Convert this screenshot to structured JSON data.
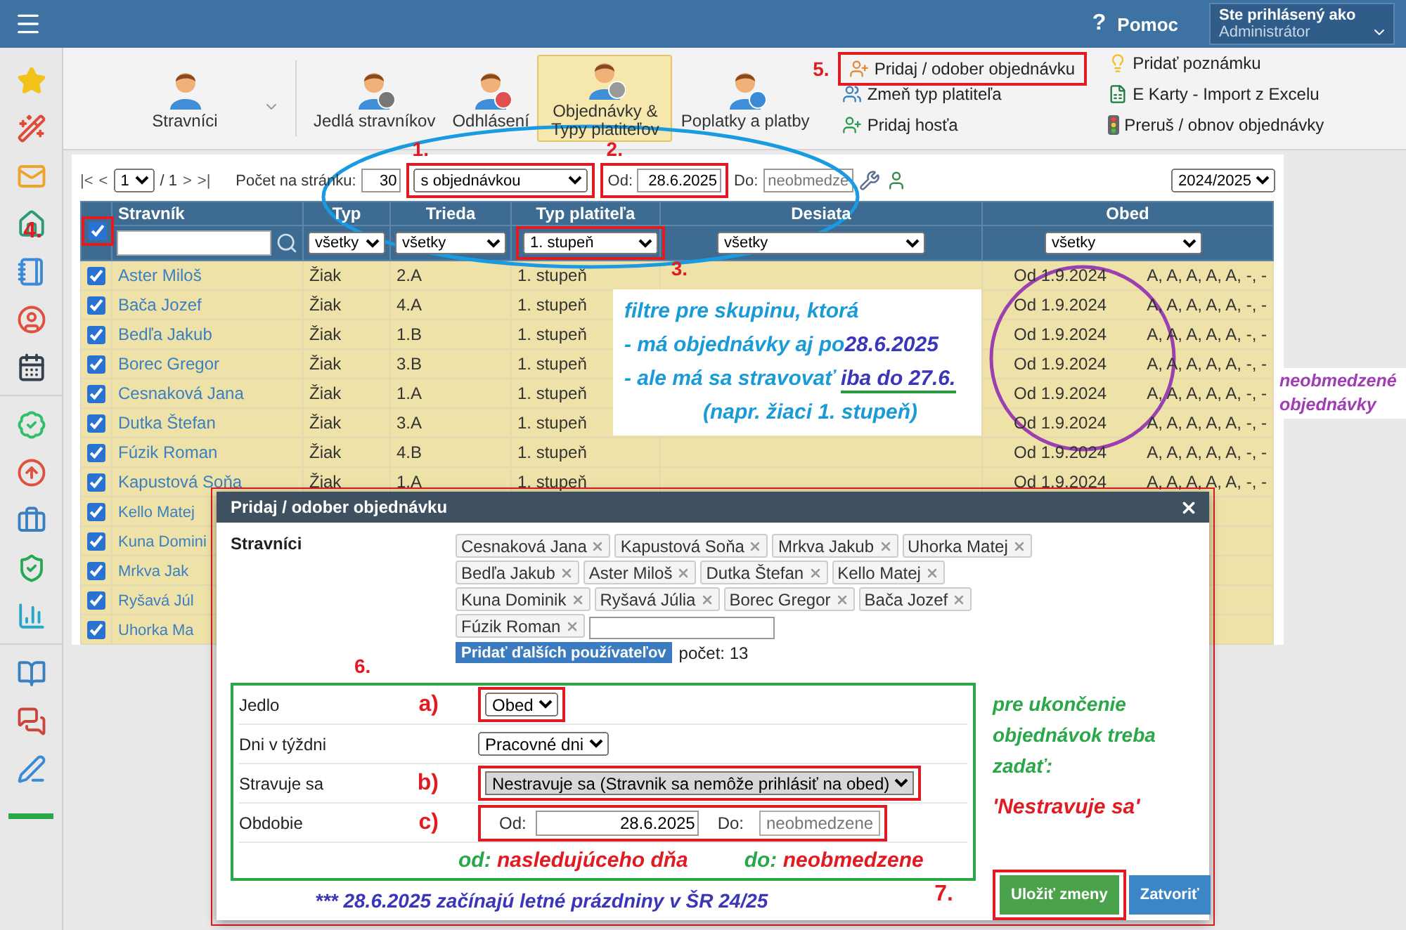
{
  "header": {
    "help_icon": "?",
    "help": "Pomoc",
    "user_label": "Ste prihlásený ako",
    "user_role": "Administrátor"
  },
  "ribbon": {
    "items": [
      {
        "label": "Stravníci",
        "selected": false,
        "dropdown": true
      },
      {
        "label": "Jedlá stravníkov",
        "selected": false
      },
      {
        "label": "Odhlásení",
        "selected": false
      },
      {
        "label": "Objednávky & Typy platiteľov",
        "selected": true
      },
      {
        "label": "Poplatky a platby",
        "selected": false
      }
    ],
    "actions": [
      {
        "label": "Pridaj / odober objednávku",
        "marker": "5."
      },
      {
        "label": "Zmeň typ platiteľa"
      },
      {
        "label": "Pridaj hosťa"
      },
      {
        "label": "Pridať poznámku"
      },
      {
        "label": "E Karty - Import z Excelu"
      },
      {
        "label": "Preruš / obnov objednávky"
      }
    ]
  },
  "pager": {
    "first": "|<",
    "prev": "<",
    "page": "1",
    "of": "/ 1",
    "next": ">",
    "last": ">|",
    "per_page_label": "Počet na stránku:",
    "per_page": "30"
  },
  "filters": {
    "status": {
      "value": "s objednávkou",
      "marker": "1."
    },
    "from": {
      "label": "Od:",
      "value": "28.6.2025",
      "marker": "2."
    },
    "to": {
      "label": "Do:",
      "placeholder": "neobmedze"
    },
    "year": "2024/2025"
  },
  "table": {
    "select_all": {
      "checked": true,
      "marker": "4."
    },
    "columns": [
      "Stravník",
      "Typ",
      "Trieda",
      "Typ platiteľa",
      "Desiata",
      "Obed"
    ],
    "column_filters": [
      {
        "kind": "search"
      },
      {
        "kind": "select",
        "value": "všetky"
      },
      {
        "kind": "select",
        "value": "všetky"
      },
      {
        "kind": "select",
        "value": "1. stupeň",
        "marker": "3."
      },
      {
        "kind": "select",
        "value": "všetky"
      },
      {
        "kind": "select",
        "value": "všetky"
      }
    ],
    "rows": [
      {
        "checked": true,
        "name": "Aster Miloš",
        "type": "Žiak",
        "class": "2.A",
        "payer": "1. stupeň",
        "lunch_from": "Od 1.9.2024",
        "lunch_days": "A, A, A, A, A, -, -"
      },
      {
        "checked": true,
        "name": "Bača Jozef",
        "type": "Žiak",
        "class": "4.A",
        "payer": "1. stupeň",
        "lunch_from": "Od 1.9.2024",
        "lunch_days": "A, A, A, A, A, -, -"
      },
      {
        "checked": true,
        "name": "Bedľa Jakub",
        "type": "Žiak",
        "class": "1.B",
        "payer": "1. stupeň",
        "lunch_from": "Od 1.9.2024",
        "lunch_days": "A, A, A, A, A, -, -"
      },
      {
        "checked": true,
        "name": "Borec Gregor",
        "type": "Žiak",
        "class": "3.B",
        "payer": "1. stupeň",
        "lunch_from": "Od 1.9.2024",
        "lunch_days": "A, A, A, A, A, -, -"
      },
      {
        "checked": true,
        "name": "Cesnaková Jana",
        "type": "Žiak",
        "class": "1.A",
        "payer": "1. stupeň",
        "lunch_from": "Od 1.9.2024",
        "lunch_days": "A, A, A, A, A, -, -"
      },
      {
        "checked": true,
        "name": "Dutka Štefan",
        "type": "Žiak",
        "class": "3.A",
        "payer": "1. stupeň",
        "lunch_from": "Od 1.9.2024",
        "lunch_days": "A, A, A, A, A, -, -"
      },
      {
        "checked": true,
        "name": "Fúzik Roman",
        "type": "Žiak",
        "class": "4.B",
        "payer": "1. stupeň",
        "lunch_from": "Od 1.9.2024",
        "lunch_days": "A, A, A, A, A, -, -"
      },
      {
        "checked": true,
        "name": "Kapustová Soňa",
        "type": "Žiak",
        "class": "1.A",
        "payer": "1. stupeň",
        "lunch_from": "Od 1.9.2024",
        "lunch_days": "A, A, A, A, A, -, -"
      },
      {
        "checked": true,
        "name": "Kello Matej"
      },
      {
        "checked": true,
        "name": "Kuna Domini"
      },
      {
        "checked": true,
        "name": "Mrkva Jak"
      },
      {
        "checked": true,
        "name": "Ryšavá Júl"
      },
      {
        "checked": true,
        "name": "Uhorka Ma"
      }
    ]
  },
  "callout": {
    "lines": [
      [
        {
          "text": "filtre pre skupinu, ktorá"
        }
      ],
      [
        {
          "text": " - má objednávky aj po"
        },
        {
          "text": "28.6.2025",
          "em": true
        }
      ],
      [
        {
          "text": " - ale má sa stravovať "
        },
        {
          "text": "iba do 27.6.",
          "em": true,
          "underline": true
        }
      ],
      [
        {
          "text": "(napr. žiaci 1. stupeň)"
        }
      ]
    ]
  },
  "column_note": "neobmedzené objednávky",
  "dialog": {
    "title": "Pridaj / odober objednávku",
    "diners_label": "Stravníci",
    "diners": [
      "Cesnaková Jana",
      "Kapustová Soňa",
      "Mrkva Jakub",
      "Uhorka Matej",
      "Bedľa Jakub",
      "Aster Miloš",
      "Dutka Štefan",
      "Kello Matej",
      "Kuna Dominik",
      "Ryšavá Júlia",
      "Borec Gregor",
      "Bača Jozef",
      "Fúzik Roman"
    ],
    "add_button": "Pridať ďalších používateľov",
    "count": "počet: 13",
    "settings": {
      "marker": "6.",
      "rows": [
        {
          "label": "Jedlo",
          "marker": "a)",
          "kind": "select",
          "value": "Obed"
        },
        {
          "label": "Dni v týždni",
          "kind": "select",
          "value": "Pracovné dni"
        },
        {
          "label": "Stravuje sa",
          "marker": "b)",
          "kind": "select",
          "value": "Nestravuje sa (Stravnik sa nemôže prihlásiť na obed)"
        },
        {
          "label": "Obdobie",
          "marker": "c)",
          "kind": "range",
          "from_label": "Od:",
          "from": "28.6.2025",
          "to_label": "Do:",
          "to_placeholder": "neobmedzene"
        }
      ],
      "hint": [
        {
          "label": "od:",
          "text": "nasledujúceho dňa"
        },
        {
          "label": "do:",
          "text": "neobmedzene"
        }
      ]
    },
    "side_note": {
      "text": "pre ukončenie objednávok treba zadať:",
      "quote": "'Nestravuje sa'"
    },
    "footnote": "*** 28.6.2025 začínajú letné prázdniny v ŠR 24/25",
    "buttons": [
      {
        "label": "Uložiť zmeny",
        "kind": "primary",
        "marker": "7."
      },
      {
        "label": "Zatvoriť",
        "kind": "secondary"
      }
    ]
  }
}
